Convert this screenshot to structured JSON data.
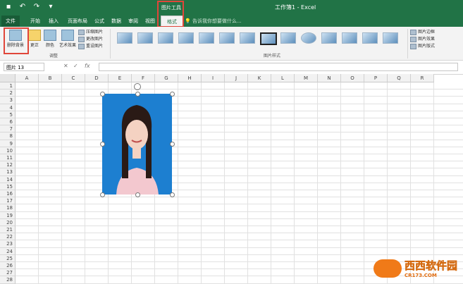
{
  "window": {
    "title": "工作簿1 - Excel",
    "context_tab_group": "图片工具"
  },
  "tabs": [
    "文件",
    "开始",
    "插入",
    "页面布局",
    "公式",
    "数据",
    "审阅",
    "视图",
    "格式"
  ],
  "active_tab": "格式",
  "tell_me": "告诉我你想要做什么...",
  "ribbon": {
    "remove_bg": "删除背景",
    "corrections": "更正",
    "color": "颜色",
    "artistic": "艺术效果",
    "compress": "压缩图片",
    "change_picture": "更改图片",
    "reset_picture": "重设图片",
    "adjust_group": "调整",
    "styles_group": "图片样式",
    "border": "图片边框",
    "effects": "图片效果",
    "layout": "图片版式"
  },
  "name_box": "图片 13",
  "columns": [
    "A",
    "B",
    "C",
    "D",
    "E",
    "F",
    "G",
    "H",
    "I",
    "J",
    "K",
    "L",
    "M",
    "N",
    "O",
    "P",
    "Q",
    "R"
  ],
  "rows": [
    "1",
    "2",
    "3",
    "4",
    "5",
    "6",
    "7",
    "8",
    "9",
    "10",
    "11",
    "12",
    "13",
    "14",
    "15",
    "16",
    "17",
    "18",
    "19",
    "20",
    "21",
    "22",
    "23",
    "24",
    "25",
    "26",
    "27",
    "28"
  ],
  "watermark": {
    "brand": "西西软件园",
    "url": "CR173.COM"
  },
  "colors": {
    "excel_green": "#217346",
    "highlight_red": "#e0463a",
    "photo_bg": "#1d7fd0"
  }
}
